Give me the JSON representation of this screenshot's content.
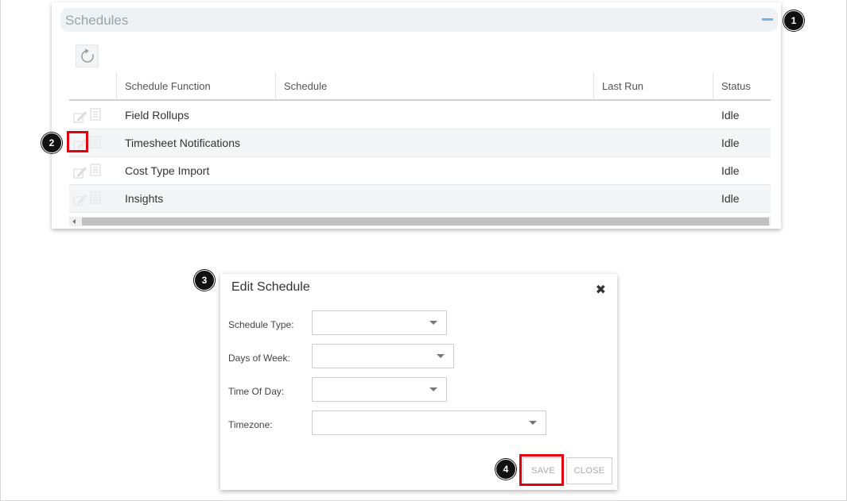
{
  "panel": {
    "title": "Schedules",
    "columns": [
      "Schedule Function",
      "Schedule",
      "Last Run",
      "Status"
    ],
    "rows": [
      {
        "function": "Field Rollups",
        "schedule": "",
        "last_run": "",
        "status": "Idle"
      },
      {
        "function": "Timesheet Notifications",
        "schedule": "",
        "last_run": "",
        "status": "Idle"
      },
      {
        "function": "Cost Type Import",
        "schedule": "",
        "last_run": "",
        "status": "Idle"
      },
      {
        "function": "Insights",
        "schedule": "",
        "last_run": "",
        "status": "Idle"
      }
    ]
  },
  "dialog": {
    "title": "Edit Schedule",
    "close_glyph": "✖",
    "fields": {
      "schedule_type": {
        "label": "Schedule Type:",
        "value": ""
      },
      "days_of_week": {
        "label": "Days of Week:",
        "value": ""
      },
      "time_of_day": {
        "label": "Time Of Day:",
        "value": ""
      },
      "timezone": {
        "label": "Timezone:",
        "value": ""
      }
    },
    "save_label": "SAVE",
    "close_label": "CLOSE"
  },
  "markers": [
    "1",
    "2",
    "3",
    "4"
  ],
  "colors": {
    "accent": "#6cb6e6",
    "highlight": "#e0000f",
    "header_bg": "#eef2f5",
    "alt_row": "#f4f5f6"
  },
  "icons": {
    "refresh": "refresh-icon",
    "edit": "edit-icon",
    "log": "document-icon",
    "collapse": "minus-icon",
    "close": "close-icon",
    "dropdown": "chevron-down-icon"
  }
}
